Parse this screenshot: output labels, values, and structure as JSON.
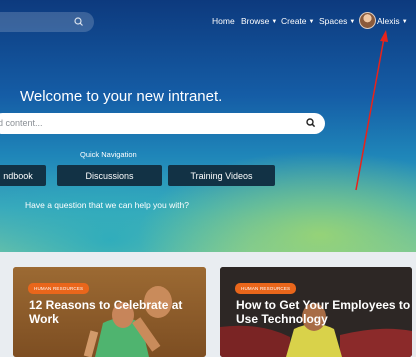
{
  "nav": {
    "home": "Home",
    "browse": "Browse",
    "create": "Create",
    "spaces": "Spaces",
    "user": "Alexis"
  },
  "hero": {
    "welcome": "Welcome to your new intranet.",
    "search_placeholder": "d content...",
    "quick_nav_title": "Quick Navigation",
    "quick_links": [
      "ndbook",
      "Discussions",
      "Training Videos"
    ],
    "question": "Have a question that we can help you with?"
  },
  "cards": [
    {
      "tag": "HUMAN RESOURCES",
      "title_line1": "12 Reasons to Celebrate at",
      "title_line2": "Work"
    },
    {
      "tag": "HUMAN RESOURCES",
      "title_line1": "How to Get Your Employees to",
      "title_line2": "Use Technology"
    }
  ],
  "colors": {
    "tag": "#e9661b",
    "quick_button": "#123245",
    "annotation_arrow": "#e8231b"
  }
}
